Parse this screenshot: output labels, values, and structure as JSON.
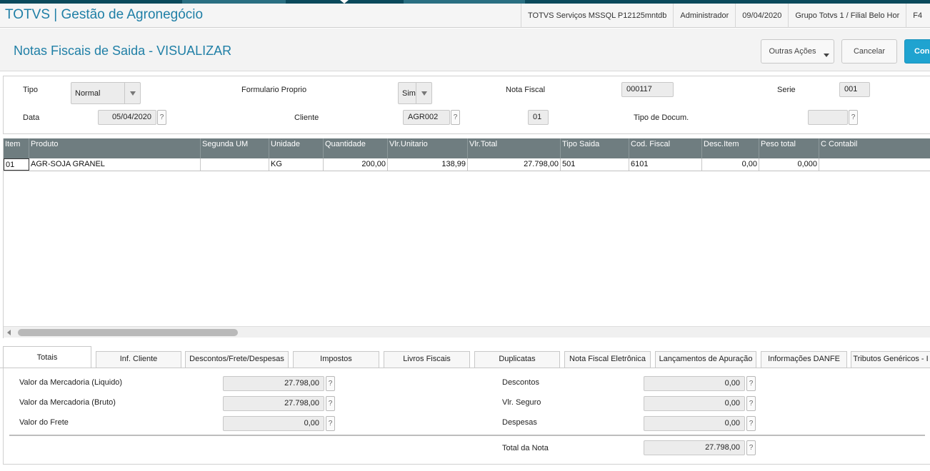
{
  "app": {
    "title": "TOTVS | Gestão de Agronegócio",
    "info": [
      "TOTVS Serviços MSSQL P12125mntdb",
      "Administrador",
      "09/04/2020",
      "Grupo Totvs 1 / Filial Belo Hor",
      "F4"
    ]
  },
  "header": {
    "title": "Notas Fiscais de Saida - VISUALIZAR",
    "outras_acoes": "Outras Ações",
    "cancelar": "Cancelar",
    "confirmar": "Con"
  },
  "form": {
    "tipo_label": "Tipo",
    "tipo_value": "Normal",
    "formulario_label": "Formulario Proprio",
    "formulario_value": "Sim",
    "nota_label": "Nota Fiscal",
    "nota_value": "000117",
    "serie_label": "Serie",
    "serie_value": "001",
    "data_label": "Data",
    "data_value": "05/04/2020",
    "cliente_label": "Cliente",
    "cliente_value": "AGR002",
    "loja_value": "01",
    "tipodoc_label": "Tipo de Docum.",
    "tipodoc_value": "",
    "help": "?"
  },
  "grid": {
    "columns": [
      "Item",
      "Produto",
      "Segunda UM",
      "Unidade",
      "Quantidade",
      "Vlr.Unitario",
      "Vlr.Total",
      "Tipo Saida",
      "Cod. Fiscal",
      "Desc.Item",
      "Peso total",
      "C Contabil"
    ],
    "rows": [
      [
        "01",
        "AGR-SOJA GRANEL",
        "",
        "KG",
        "200,00",
        "138,99",
        "27.798,00",
        "501",
        "6101",
        "0,00",
        "0,000",
        ""
      ]
    ]
  },
  "tabs": [
    "Totais",
    "Inf. Cliente",
    "Descontos/Frete/Despesas",
    "Impostos",
    "Livros Fiscais",
    "Duplicatas",
    "Nota Fiscal Eletrônica",
    "Lançamentos de Apuração",
    "Informações DANFE",
    "Tributos Genéricos - I"
  ],
  "totals": {
    "merc_liq_label": "Valor da Mercadoria (Liquido)",
    "merc_liq_value": "27.798,00",
    "merc_bruto_label": "Valor da Mercadoria (Bruto)",
    "merc_bruto_value": "27.798,00",
    "frete_label": "Valor do Frete",
    "frete_value": "0,00",
    "descontos_label": "Descontos",
    "descontos_value": "0,00",
    "seguro_label": "Vlr. Seguro",
    "seguro_value": "0,00",
    "despesas_label": "Despesas",
    "despesas_value": "0,00",
    "total_label": "Total da Nota",
    "total_value": "27.798,00"
  },
  "colors": {
    "accent": "#1f7fa6",
    "primary_button": "#1fa3d0",
    "grid_header": "#6f7d80",
    "top_strip": "#0b4a5c"
  }
}
